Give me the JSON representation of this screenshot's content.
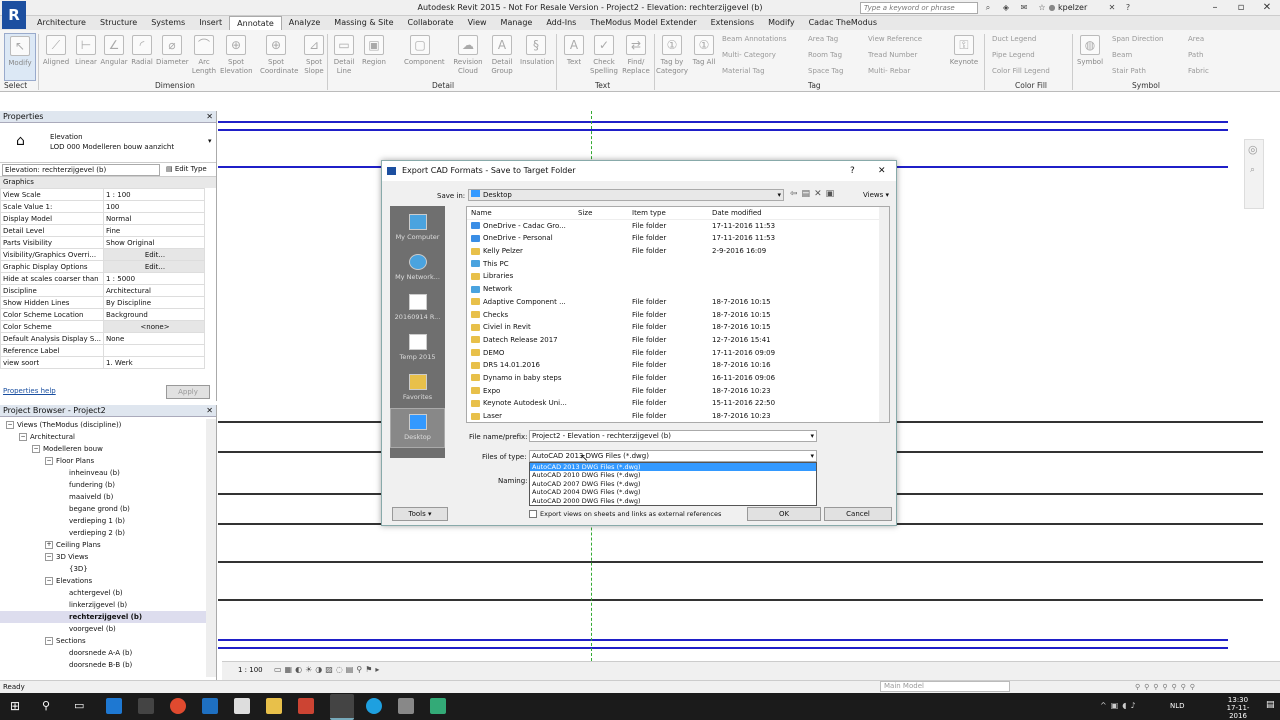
{
  "app": {
    "title": "Autodesk Revit 2015 -  Not For Resale Version -   Project2 - Elevation: rechterzijgevel (b)",
    "search_placeholder": "Type a keyword or phrase",
    "user": "kpelzer"
  },
  "ribbon_tabs": [
    "Architecture",
    "Structure",
    "Systems",
    "Insert",
    "Annotate",
    "Analyze",
    "Massing & Site",
    "Collaborate",
    "View",
    "Manage",
    "Add-Ins",
    "TheModus Model Extender",
    "Extensions",
    "Modify",
    "Cadac TheModus"
  ],
  "active_tab": "Annotate",
  "ribbon": {
    "modify": "Modify",
    "select": "Select",
    "dimension_buttons": [
      "Aligned",
      "Linear",
      "Angular",
      "Radial",
      "Diameter",
      "Arc Length",
      "Spot Elevation",
      "Spot Coordinate",
      "Spot Slope"
    ],
    "detail_buttons": [
      "Detail Line",
      "Region",
      "Component",
      "Revision Cloud",
      "Detail Group",
      "Insulation"
    ],
    "text_buttons": [
      "Text",
      "Check Spelling",
      "Find/ Replace"
    ],
    "tag_buttons": [
      "Tag by Category",
      "Tag All"
    ],
    "tag_small": [
      "Beam Annotations",
      "Multi- Category",
      "Material Tag",
      "Area Tag",
      "Room Tag",
      "Space Tag",
      "View Reference",
      "Tread Number",
      "Multi- Rebar"
    ],
    "keynote": "Keynote",
    "color_fill_small": [
      "Duct Legend",
      "Pipe Legend",
      "Color Fill Legend"
    ],
    "symbol": "Symbol",
    "symbol_small": [
      "Span Direction",
      "Beam",
      "Stair Path",
      "Area",
      "Path",
      "Fabric"
    ],
    "groups": [
      "Select",
      "Dimension",
      "Detail",
      "Text",
      "Tag",
      "Color Fill",
      "Symbol"
    ]
  },
  "properties": {
    "title": "Properties",
    "type_line1": "Elevation",
    "type_line2": "LOD 000 Modelleren bouw aanzicht",
    "selector": "Elevation: rechterzijgevel (b)",
    "edit_type": "Edit Type",
    "section": "Graphics",
    "rows": [
      {
        "k": "View Scale",
        "v": "1 : 100"
      },
      {
        "k": "Scale Value    1:",
        "v": "100"
      },
      {
        "k": "Display Model",
        "v": "Normal"
      },
      {
        "k": "Detail Level",
        "v": "Fine"
      },
      {
        "k": "Parts Visibility",
        "v": "Show Original"
      },
      {
        "k": "Visibility/Graphics Overri...",
        "v": "Edit..."
      },
      {
        "k": "Graphic Display Options",
        "v": "Edit..."
      },
      {
        "k": "Hide at scales coarser than",
        "v": "1 : 5000"
      },
      {
        "k": "Discipline",
        "v": "Architectural"
      },
      {
        "k": "Show Hidden Lines",
        "v": "By Discipline"
      },
      {
        "k": "Color Scheme Location",
        "v": "Background"
      },
      {
        "k": "Color Scheme",
        "v": "<none>"
      },
      {
        "k": "Default Analysis Display S...",
        "v": "None"
      },
      {
        "k": "Reference Label",
        "v": ""
      },
      {
        "k": "view soort",
        "v": "1. Werk"
      }
    ],
    "help": "Properties help",
    "apply": "Apply"
  },
  "browser": {
    "title": "Project Browser - Project2",
    "items": [
      {
        "t": "Views (TheModus (discipline))",
        "lvl": 0,
        "tw": "−"
      },
      {
        "t": "Architectural",
        "lvl": 1,
        "tw": "−"
      },
      {
        "t": "Modelleren bouw",
        "lvl": 2,
        "tw": "−"
      },
      {
        "t": "Floor Plans",
        "lvl": 3,
        "tw": "−"
      },
      {
        "t": "inheinveau (b)",
        "lvl": 4,
        "tw": ""
      },
      {
        "t": "fundering (b)",
        "lvl": 4,
        "tw": ""
      },
      {
        "t": "maaiveld (b)",
        "lvl": 4,
        "tw": ""
      },
      {
        "t": "begane grond (b)",
        "lvl": 4,
        "tw": ""
      },
      {
        "t": "verdieping 1 (b)",
        "lvl": 4,
        "tw": ""
      },
      {
        "t": "verdieping 2 (b)",
        "lvl": 4,
        "tw": ""
      },
      {
        "t": "Ceiling Plans",
        "lvl": 3,
        "tw": "+"
      },
      {
        "t": "3D Views",
        "lvl": 3,
        "tw": "−"
      },
      {
        "t": "{3D}",
        "lvl": 4,
        "tw": ""
      },
      {
        "t": "Elevations",
        "lvl": 3,
        "tw": "−"
      },
      {
        "t": "achtergevel (b)",
        "lvl": 4,
        "tw": ""
      },
      {
        "t": "linkerzijgevel (b)",
        "lvl": 4,
        "tw": ""
      },
      {
        "t": "rechterzijgevel (b)",
        "lvl": 4,
        "tw": "",
        "bold": true
      },
      {
        "t": "voorgevel (b)",
        "lvl": 4,
        "tw": ""
      },
      {
        "t": "Sections",
        "lvl": 3,
        "tw": "−"
      },
      {
        "t": "doorsnede A-A (b)",
        "lvl": 4,
        "tw": ""
      },
      {
        "t": "doorsnede B-B (b)",
        "lvl": 4,
        "tw": ""
      }
    ]
  },
  "dialog": {
    "title": "Export CAD Formats - Save to Target Folder",
    "save_in_label": "Save in:",
    "save_in_value": "Desktop",
    "views": "Views",
    "places": [
      "My Computer",
      "My Network...",
      "20160914 R...",
      "Temp 2015",
      "Favorites",
      "Desktop"
    ],
    "columns": [
      "Name",
      "Size",
      "Item type",
      "Date modified"
    ],
    "files": [
      {
        "name": "OneDrive - Cadac Gro...",
        "type": "File folder",
        "date": "17-11-2016 11:53",
        "icon": "cloud"
      },
      {
        "name": "OneDrive - Personal",
        "type": "File folder",
        "date": "17-11-2016 11:53",
        "icon": "cloud"
      },
      {
        "name": "Kelly Pelzer",
        "type": "File folder",
        "date": "2-9-2016 16:09",
        "icon": "user"
      },
      {
        "name": "This PC",
        "type": "",
        "date": "",
        "icon": "pc"
      },
      {
        "name": "Libraries",
        "type": "",
        "date": "",
        "icon": "lib"
      },
      {
        "name": "Network",
        "type": "",
        "date": "",
        "icon": "net"
      },
      {
        "name": "Adaptive Component ...",
        "type": "File folder",
        "date": "18-7-2016 10:15",
        "icon": "folder"
      },
      {
        "name": "Checks",
        "type": "File folder",
        "date": "18-7-2016 10:15",
        "icon": "folder"
      },
      {
        "name": "Civiel in Revit",
        "type": "File folder",
        "date": "18-7-2016 10:15",
        "icon": "folder"
      },
      {
        "name": "Datech Release 2017",
        "type": "File folder",
        "date": "12-7-2016 15:41",
        "icon": "folder"
      },
      {
        "name": "DEMO",
        "type": "File folder",
        "date": "17-11-2016 09:09",
        "icon": "folder"
      },
      {
        "name": "DRS 14.01.2016",
        "type": "File folder",
        "date": "18-7-2016 10:16",
        "icon": "folder"
      },
      {
        "name": "Dynamo in baby steps",
        "type": "File folder",
        "date": "16-11-2016 09:06",
        "icon": "folder"
      },
      {
        "name": "Expo",
        "type": "File folder",
        "date": "18-7-2016 10:23",
        "icon": "folder"
      },
      {
        "name": "Keynote Autodesk Uni...",
        "type": "File folder",
        "date": "15-11-2016 22:50",
        "icon": "folder"
      },
      {
        "name": "Laser",
        "type": "File folder",
        "date": "18-7-2016 10:23",
        "icon": "folder"
      }
    ],
    "filename_label": "File name/prefix:",
    "filename_value": "Project2 - Elevation - rechterzijgevel (b)",
    "filetype_label": "Files of type:",
    "filetype_value": "AutoCAD 2013 DWG Files  (*.dwg)",
    "filetype_options": [
      "AutoCAD 2013 DWG Files  (*.dwg)",
      "AutoCAD 2010 DWG Files  (*.dwg)",
      "AutoCAD 2007 DWG Files  (*.dwg)",
      "AutoCAD 2004 DWG Files  (*.dwg)",
      "AutoCAD 2000 DWG Files  (*.dwg)"
    ],
    "naming_label": "Naming:",
    "export_check": "Export views on sheets and links as external references",
    "tools": "Tools",
    "ok": "OK",
    "cancel": "Cancel"
  },
  "view_control": {
    "scale": "1 : 100"
  },
  "status": {
    "text": "Ready",
    "model": "Main Model"
  },
  "clock": {
    "time": "13:30",
    "date": "17-11-2016",
    "lang": "NLD"
  },
  "colors": {
    "accent": "#1c4fa0",
    "line_blue": "#1f1fc8",
    "selection": "#3399ff"
  }
}
